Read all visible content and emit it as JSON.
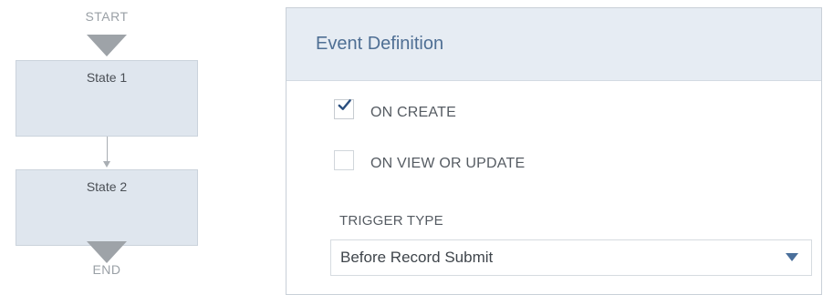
{
  "workflow": {
    "start_label": "START",
    "end_label": "END",
    "states": [
      {
        "label": "State 1"
      },
      {
        "label": "State 2"
      }
    ]
  },
  "event_definition": {
    "title": "Event Definition",
    "options": [
      {
        "label": "ON CREATE",
        "checked": true
      },
      {
        "label": "ON VIEW OR UPDATE",
        "checked": false
      }
    ],
    "trigger_type": {
      "label": "TRIGGER TYPE",
      "selected": "Before Record Submit"
    }
  },
  "colors": {
    "panel_header_bg": "#e6ecf3",
    "title_text": "#4f6f94",
    "state_box_bg": "#dfe6ee",
    "checkmark": "#2b4f7e",
    "dropdown_arrow": "#4a6f9b"
  }
}
